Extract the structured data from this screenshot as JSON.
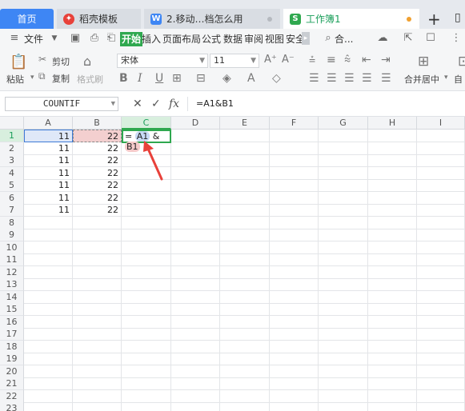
{
  "tabs": {
    "home": "首页",
    "docer": "稻壳模板",
    "doc": "2.移动…档怎么用",
    "sheet": "工作簿1",
    "new_tab_symbol": "+",
    "more_symbol": "▯"
  },
  "menu": {
    "file": "文件",
    "items": [
      "开始",
      "插入",
      "页面布局",
      "公式",
      "数据",
      "审阅",
      "视图",
      "安全"
    ],
    "search": "合..."
  },
  "ribbon": {
    "paste": "粘贴",
    "cut": "剪切",
    "copy": "复制",
    "format_painter": "格式刷",
    "font_name": "宋体",
    "font_size": "11",
    "merge_center": "合并居中",
    "auto_wrap": "自"
  },
  "formula_bar": {
    "name_box": "COUNTIF",
    "formula": "=A1&B1"
  },
  "sheet": {
    "columns": [
      "A",
      "B",
      "C",
      "D",
      "E",
      "F",
      "G",
      "H",
      "I"
    ],
    "rows": [
      "1",
      "2",
      "3",
      "4",
      "5",
      "6",
      "7",
      "8",
      "9",
      "10",
      "11",
      "12",
      "13",
      "14",
      "15",
      "16",
      "17",
      "18",
      "19",
      "20",
      "21",
      "22",
      "23"
    ],
    "col_a": [
      "11",
      "11",
      "11",
      "11",
      "11",
      "11",
      "11"
    ],
    "col_b": [
      "22",
      "22",
      "22",
      "22",
      "22",
      "22",
      "22"
    ],
    "c1_prefix": "=",
    "c1_ref_a": "A1",
    "c1_amp": "&",
    "c1_ref_b": "B1"
  },
  "colors": {
    "accent_green": "#2fa84f",
    "home_tab_blue": "#3e86f4",
    "annotation_red": "#e8413a"
  }
}
